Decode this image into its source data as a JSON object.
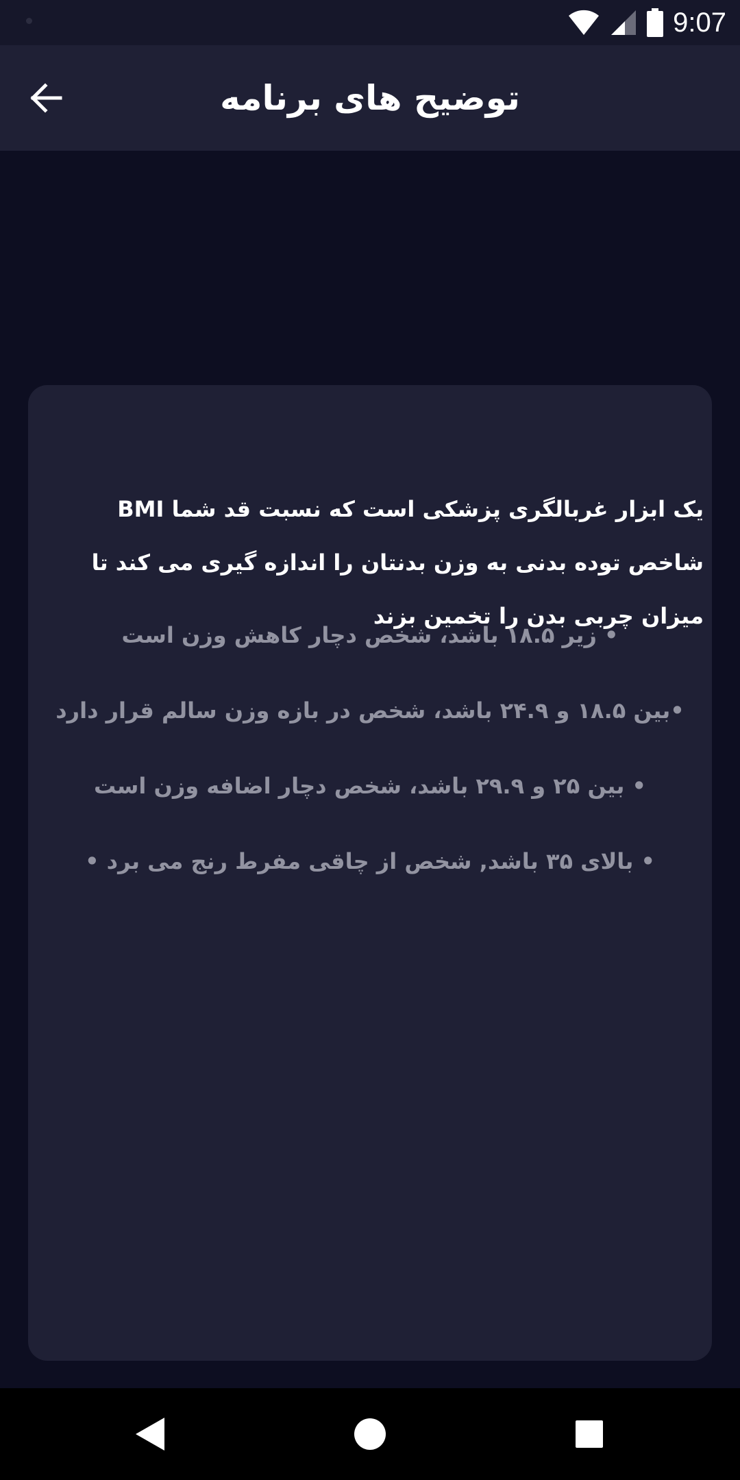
{
  "status_bar": {
    "time": "9:07",
    "icons": [
      "wifi-icon",
      "signal-icon",
      "battery-icon"
    ]
  },
  "app_bar": {
    "title": "توضیح های برنامه",
    "back_icon": "arrow-back-icon"
  },
  "content": {
    "intro": "یک ابزار غربالگری پزشکی است که نسبت قد شما BMI شاخص توده بدنی به وزن بدنتان را اندازه گیری می کند تا میزان چربی بدن را تخمین بزند",
    "bullets": [
      "• زیر ۱۸.۵ باشد، شخص دچار کاهش وزن است",
      "•بین ۱۸.۵ و ۲۴.۹ باشد، شخص در بازه وزن سالم قرار دارد",
      "• بین ۲۵ و ۲۹.۹ باشد، شخص دچار اضافه وزن است",
      "• بالای ۳۵ باشد, شخص از چاقی مفرط رنج می برد •"
    ]
  },
  "nav_bar": {
    "icons": [
      "back-triangle-icon",
      "home-circle-icon",
      "recents-square-icon"
    ]
  },
  "colors": {
    "background": "#0d0e21",
    "surface": "#1f2035",
    "status_bar": "#16172a",
    "text_primary": "#ffffff",
    "text_secondary": "#9293a1"
  }
}
